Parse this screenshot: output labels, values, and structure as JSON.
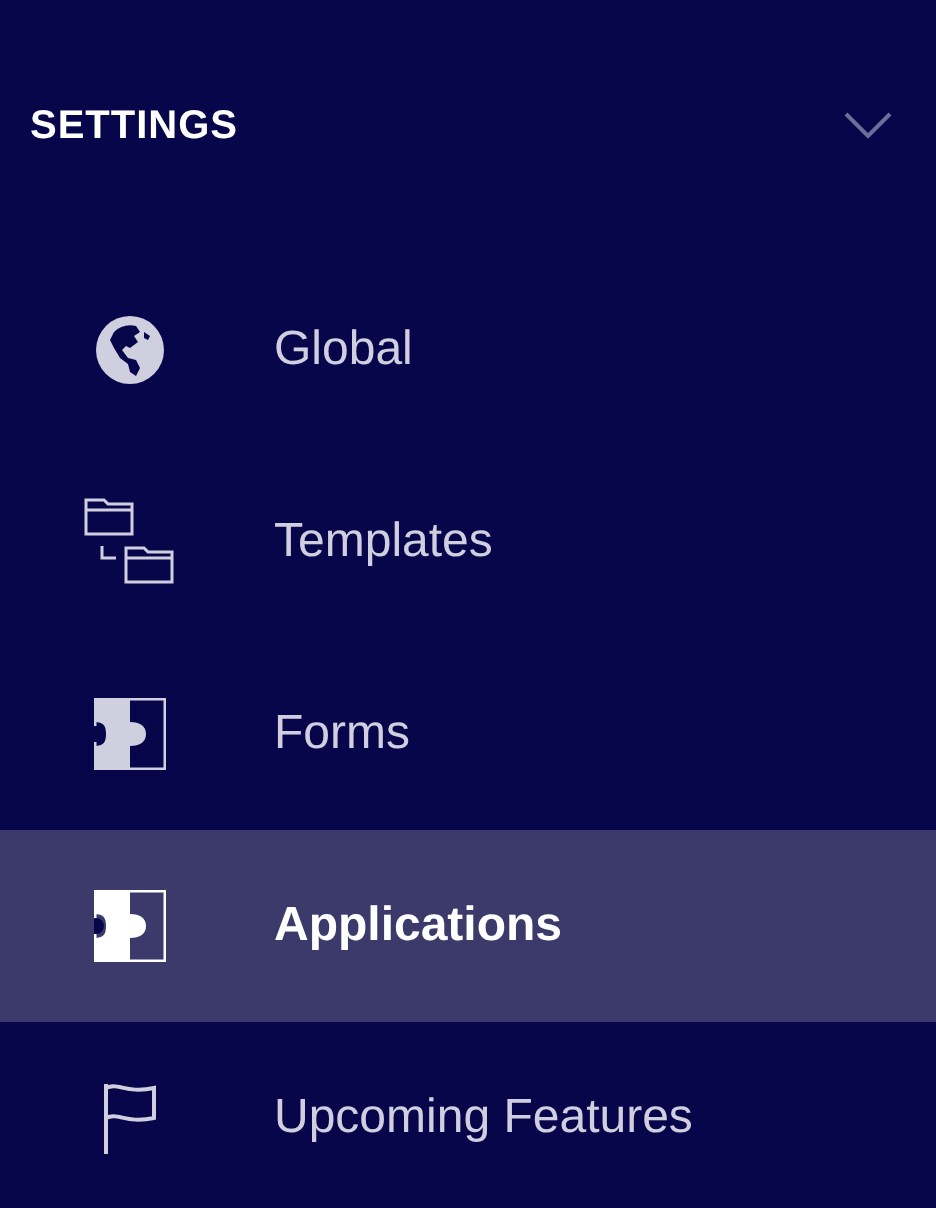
{
  "section": {
    "title": "SETTINGS",
    "expanded": true
  },
  "items": [
    {
      "label": "Global",
      "kind": "globe",
      "selected": false
    },
    {
      "label": "Templates",
      "kind": "folders",
      "selected": false
    },
    {
      "label": "Forms",
      "kind": "puzzle",
      "selected": false
    },
    {
      "label": "Applications",
      "kind": "puzzle",
      "selected": true
    },
    {
      "label": "Upcoming Features",
      "kind": "flag",
      "selected": false
    }
  ]
}
